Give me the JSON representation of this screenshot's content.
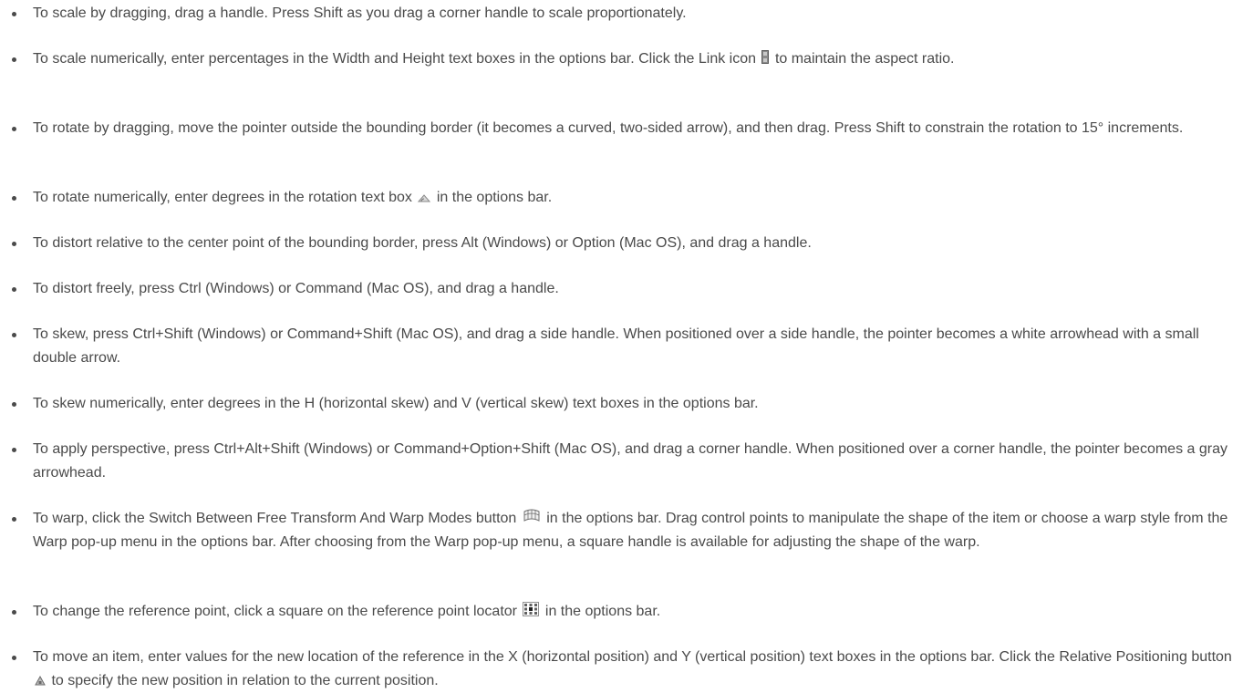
{
  "items": [
    {
      "text": "To scale by dragging, drag a handle. Press Shift as you drag a corner handle to scale proportionately."
    },
    {
      "before": "To scale numerically, enter percentages in the Width and Height text boxes in the options bar. Click the Link icon",
      "icon": "link-icon",
      "after": "to maintain the aspect ratio."
    },
    {
      "text": "To rotate by dragging, move the pointer outside the bounding border (it becomes a curved, two-sided arrow), and then drag. Press Shift to constrain the rotation to 15° increments."
    },
    {
      "before": "To rotate numerically, enter degrees in the rotation text box",
      "icon": "rotation-icon",
      "after": "in the options bar."
    },
    {
      "text": "To distort relative to the center point of the bounding border, press Alt (Windows) or Option (Mac OS), and drag a handle."
    },
    {
      "text": "To distort freely, press Ctrl (Windows) or Command (Mac OS), and drag a handle."
    },
    {
      "text": "To skew, press Ctrl+Shift (Windows) or Command+Shift (Mac OS), and drag a side handle. When positioned over a side handle, the pointer becomes a white arrowhead with a small double arrow."
    },
    {
      "text": "To skew numerically, enter degrees in the H (horizontal skew) and V (vertical skew) text boxes in the options bar."
    },
    {
      "text": "To apply perspective, press Ctrl+Alt+Shift (Windows) or Command+Option+Shift (Mac OS), and drag a corner handle. When positioned over a corner handle, the pointer becomes a gray arrowhead."
    },
    {
      "before": "To warp, click the Switch Between Free Transform And Warp Modes button",
      "icon": "warp-mode-icon",
      "after": "in the options bar. Drag control points to manipulate the shape of the item or choose a warp style from the Warp pop-up menu in the options bar. After choosing from the Warp pop-up menu, a square handle is available for adjusting the shape of the warp."
    },
    {
      "before": "To change the reference point, click a square on the reference point locator",
      "icon": "reference-point-locator-icon",
      "after": "in the options bar."
    },
    {
      "before": "To move an item, enter values for the new location of the reference in the X (horizontal position) and Y (vertical position) text boxes in the options bar. Click the Relative Positioning button",
      "icon": "relative-positioning-icon",
      "after": "to specify the new position in relation to the current position."
    }
  ]
}
